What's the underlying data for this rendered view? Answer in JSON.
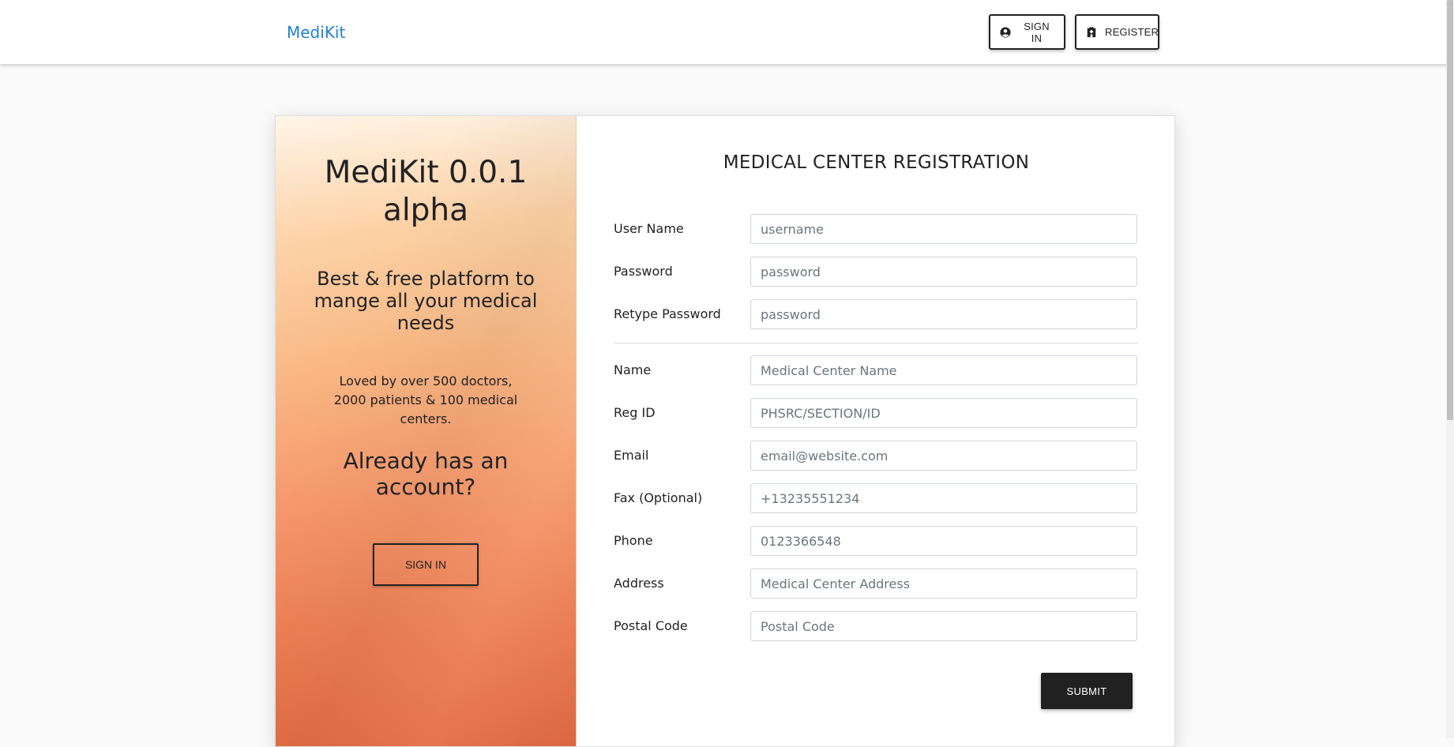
{
  "navbar": {
    "brand": "MediKit",
    "signin_label": "SIGN IN",
    "register_label": "REGISTER",
    "signin_icon": "user-circle-icon",
    "register_icon": "hospital-icon"
  },
  "promo": {
    "title": "MediKit 0.0.1 alpha",
    "tagline": "Best & free platform to mange all your medical needs",
    "loved": "Loved by over 500 doctors, 2000 patients & 100 medical centers.",
    "already": "Already has an account?",
    "signin_label": "SIGN IN"
  },
  "form": {
    "title": "MEDICAL CENTER REGISTRATION",
    "fields": [
      {
        "label": "User Name",
        "placeholder": "username",
        "value": ""
      },
      {
        "label": "Password",
        "placeholder": "password",
        "value": ""
      },
      {
        "label": "Retype Password",
        "placeholder": "password",
        "value": ""
      },
      {
        "label": "Name",
        "placeholder": "Medical Center Name",
        "value": ""
      },
      {
        "label": "Reg ID",
        "placeholder": "PHSRC/SECTION/ID",
        "value": ""
      },
      {
        "label": "Email",
        "placeholder": "email@website.com",
        "value": ""
      },
      {
        "label": "Fax (Optional)",
        "placeholder": "+13235551234",
        "value": ""
      },
      {
        "label": "Phone",
        "placeholder": "0123366548",
        "value": ""
      },
      {
        "label": "Address",
        "placeholder": "Medical Center Address",
        "value": ""
      },
      {
        "label": "Postal Code",
        "placeholder": "Postal Code",
        "value": ""
      }
    ],
    "submit_label": "SUBMIT"
  },
  "colors": {
    "brand": "#1e7fd6",
    "submit_bg": "#212121",
    "promo_top": "#fff4e6",
    "promo_bottom": "#e26a40"
  }
}
